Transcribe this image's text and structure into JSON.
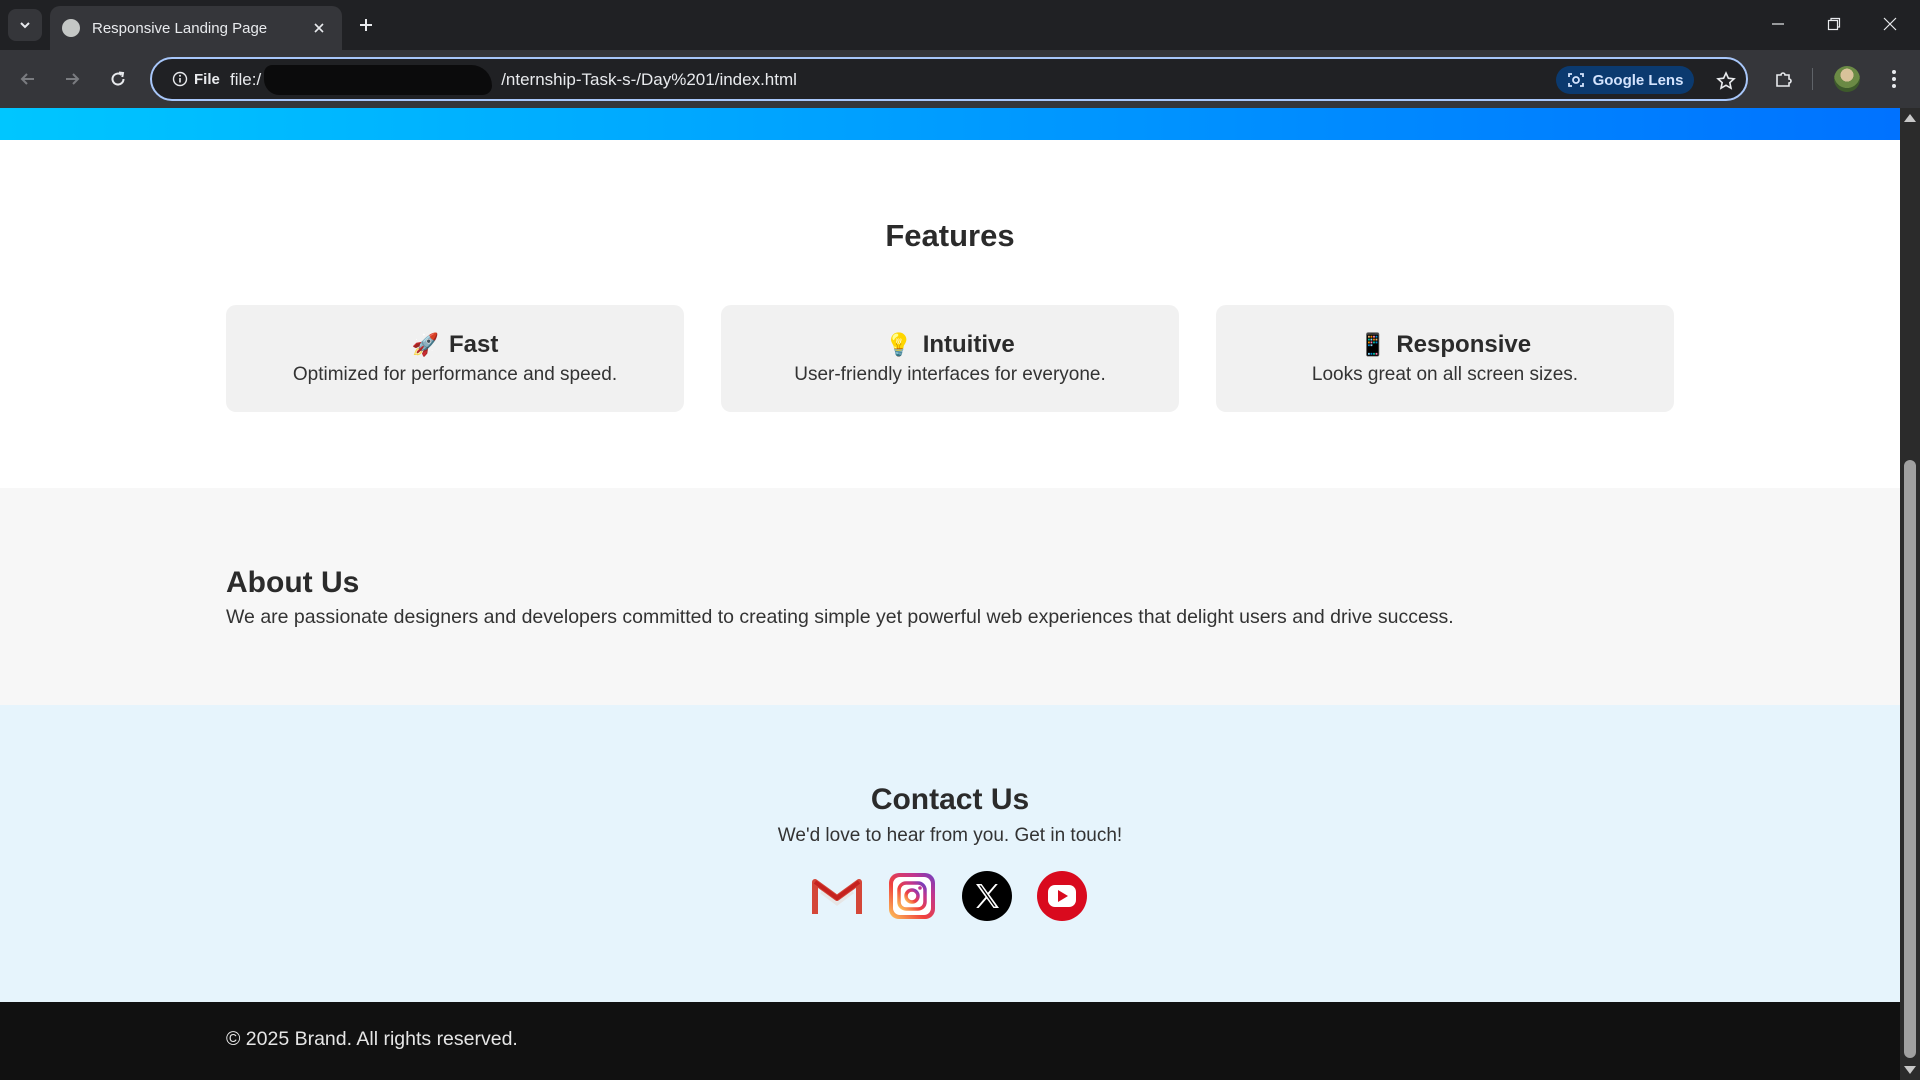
{
  "browser": {
    "tab": {
      "title": "Responsive Landing Page"
    },
    "omnibox": {
      "site_chip": "File",
      "url": "file:///ernship-Task-s-/Day%201/index.html",
      "url_prefix": "file:/",
      "url_suffix": "/nternship-Task-s-/Day%201/index.html"
    },
    "lens": {
      "label": "Google Lens"
    },
    "icons": [
      "tab-search",
      "globe",
      "close",
      "plus",
      "minimize",
      "restore",
      "close",
      "back",
      "forward",
      "reload",
      "info",
      "lens",
      "star",
      "extensions",
      "avatar",
      "kebab"
    ]
  },
  "page": {
    "hero_gradient": [
      "#00c6ff",
      "#0072ff"
    ],
    "features": {
      "title": "Features",
      "cards": [
        {
          "emoji": "🚀",
          "icon": "rocket-icon",
          "title": "Fast",
          "desc": "Optimized for performance and speed."
        },
        {
          "emoji": "💡",
          "icon": "lightbulb-icon",
          "title": "Intuitive",
          "desc": "User-friendly interfaces for everyone."
        },
        {
          "emoji": "📱",
          "icon": "phone-icon",
          "title": "Responsive",
          "desc": "Looks great on all screen sizes."
        }
      ]
    },
    "about": {
      "title": "About Us",
      "text": "We are passionate designers and developers committed to creating simple yet powerful web experiences that delight users and drive success."
    },
    "contact": {
      "title": "Contact Us",
      "subtitle": "We'd love to hear from you. Get in touch!",
      "socials": [
        "gmail-icon",
        "instagram-icon",
        "x-icon",
        "youtube-icon"
      ]
    },
    "footer": {
      "text": "© 2025 Brand. All rights reserved."
    }
  },
  "colors": {
    "chrome_bg": "#202124",
    "toolbar_bg": "#35363a",
    "focus_ring": "#a8c7fa",
    "about_bg": "#f7f7f7",
    "contact_bg": "#e6f4fc",
    "footer_bg": "#111111"
  }
}
